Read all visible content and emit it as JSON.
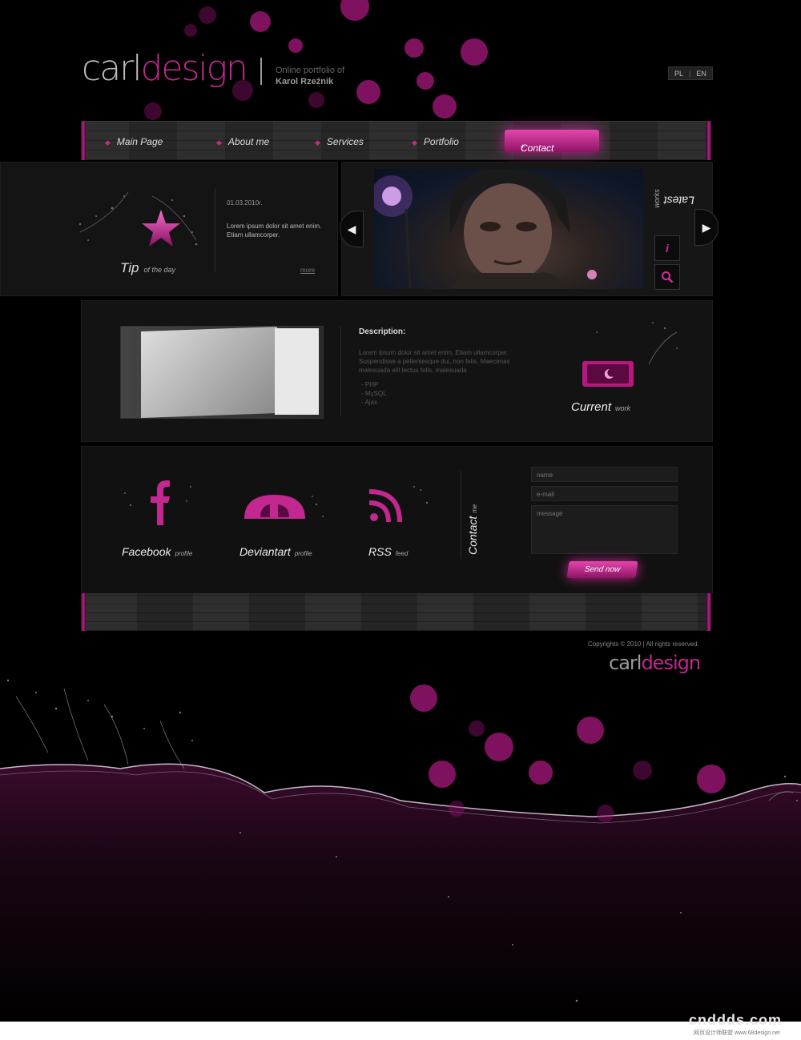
{
  "brand": {
    "logo_part1": "carl",
    "logo_part2": "design",
    "tagline_line1": "Online portfolio of",
    "tagline_line2": "Karol Rzeźnik"
  },
  "languages": [
    "PL",
    "EN"
  ],
  "nav": {
    "items": [
      "Main Page",
      "About me",
      "Services",
      "Portfolio"
    ],
    "active": "Contact"
  },
  "tip": {
    "title": "Tip",
    "subtitle": "of the day",
    "date": "01.03.2010r.",
    "text": "Lorem ipsum dolor sit amet enim. Etiam ullamcorper.",
    "more": "more"
  },
  "latest": {
    "title": "Latest",
    "subtitle": "works"
  },
  "current_work": {
    "description_title": "Description:",
    "description_text": "Lorem ipsum dolor sit amet enim. Etiam ullamcorper. Suspendisse a pellentesque dui, non felis. Maecenas malesuada elit lectus felis, malesuada",
    "tech": [
      "- PHP",
      "- MySQL",
      "- Ajax"
    ],
    "title": "Current",
    "subtitle": "work"
  },
  "social": [
    {
      "title": "Facebook",
      "subtitle": "profile",
      "icon": "facebook-icon"
    },
    {
      "title": "Deviantart",
      "subtitle": "profile",
      "icon": "deviantart-icon"
    },
    {
      "title": "RSS",
      "subtitle": "feed",
      "icon": "rss-icon"
    }
  ],
  "contact": {
    "title": "Contact",
    "subtitle": "me",
    "name_placeholder": "name",
    "email_placeholder": "e-mail",
    "message_placeholder": "message",
    "send_label": "Send now"
  },
  "footer": {
    "copyright": "Copyrights © 2010  |  All rights reserved."
  },
  "watermark": {
    "text": "cnddds.com",
    "sub": "网页设计师联盟 www.68design.net"
  },
  "colors": {
    "accent": "#c2288f",
    "background": "#000000"
  }
}
